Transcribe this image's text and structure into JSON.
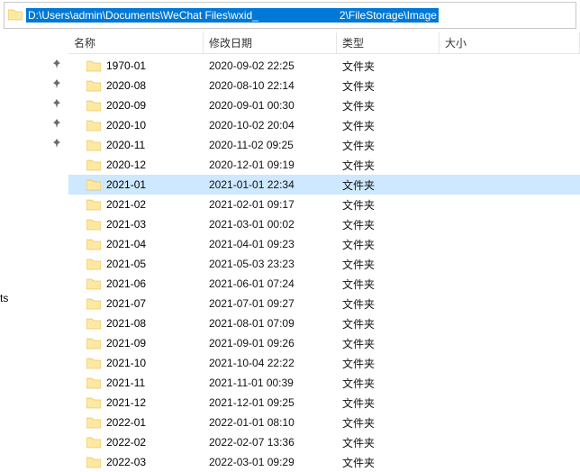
{
  "address": {
    "path_before": "D:\\Users\\admin\\Documents\\WeChat Files\\wxid_",
    "path_after": "2\\FileStorage\\Image"
  },
  "columns": {
    "name": "名称",
    "date": "修改日期",
    "type": "类型",
    "size": "大小"
  },
  "pins": [
    0,
    1,
    2,
    3,
    4
  ],
  "left_cut_label": "ts",
  "type_label": "文件夹",
  "selected_index": 6,
  "rows": [
    {
      "name": "1970-01",
      "date": "2020-09-02 22:25"
    },
    {
      "name": "2020-08",
      "date": "2020-08-10 22:14"
    },
    {
      "name": "2020-09",
      "date": "2020-09-01 00:30"
    },
    {
      "name": "2020-10",
      "date": "2020-10-02 20:04"
    },
    {
      "name": "2020-11",
      "date": "2020-11-02 09:25"
    },
    {
      "name": "2020-12",
      "date": "2020-12-01 09:19"
    },
    {
      "name": "2021-01",
      "date": "2021-01-01 22:34"
    },
    {
      "name": "2021-02",
      "date": "2021-02-01 09:17"
    },
    {
      "name": "2021-03",
      "date": "2021-03-01 00:02"
    },
    {
      "name": "2021-04",
      "date": "2021-04-01 09:23"
    },
    {
      "name": "2021-05",
      "date": "2021-05-03 23:23"
    },
    {
      "name": "2021-06",
      "date": "2021-06-01 07:24"
    },
    {
      "name": "2021-07",
      "date": "2021-07-01 09:27"
    },
    {
      "name": "2021-08",
      "date": "2021-08-01 07:09"
    },
    {
      "name": "2021-09",
      "date": "2021-09-01 09:26"
    },
    {
      "name": "2021-10",
      "date": "2021-10-04 22:22"
    },
    {
      "name": "2021-11",
      "date": "2021-11-01 00:39"
    },
    {
      "name": "2021-12",
      "date": "2021-12-01 09:25"
    },
    {
      "name": "2022-01",
      "date": "2022-01-01 08:10"
    },
    {
      "name": "2022-02",
      "date": "2022-02-07 13:36"
    },
    {
      "name": "2022-03",
      "date": "2022-03-01 09:29"
    }
  ]
}
